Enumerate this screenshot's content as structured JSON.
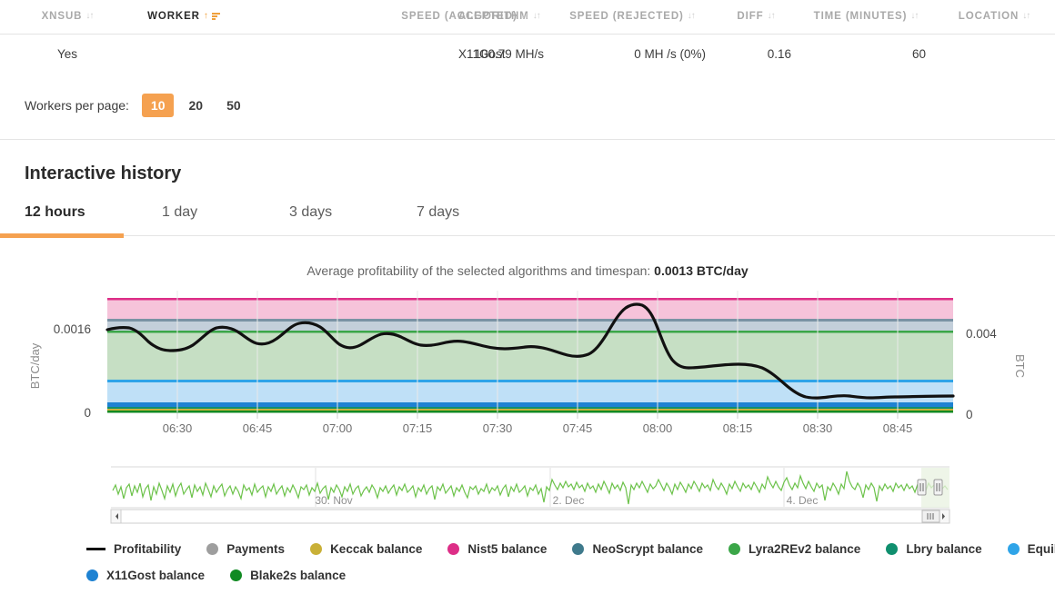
{
  "table": {
    "columns": [
      {
        "label": "XNSUB",
        "sorted": false
      },
      {
        "label": "WORKER",
        "sorted": true
      },
      {
        "label": "ALGORITHM",
        "sorted": false
      },
      {
        "label": "SPEED (ACCEPTED)",
        "sorted": false
      },
      {
        "label": "SPEED (REJECTED)",
        "sorted": false
      },
      {
        "label": "DIFF",
        "sorted": false
      },
      {
        "label": "TIME (MINUTES)",
        "sorted": false
      },
      {
        "label": "LOCATION",
        "sorted": false
      }
    ],
    "rows": [
      {
        "xnsub": "Yes",
        "worker": "",
        "algorithm": "X11Gost",
        "speed_accepted": "100.79 MH/s",
        "speed_rejected": "0 MH /s (0%)",
        "diff": "0.16",
        "time_minutes": "60",
        "location": ""
      }
    ]
  },
  "pagination": {
    "label": "Workers per page:",
    "options": [
      "10",
      "20",
      "50"
    ],
    "selected": "10"
  },
  "history": {
    "title": "Interactive history",
    "tabs": [
      {
        "label": "12 hours",
        "active": true
      },
      {
        "label": "1 day",
        "active": false
      },
      {
        "label": "3 days",
        "active": false
      },
      {
        "label": "7 days",
        "active": false
      }
    ],
    "subtitle_prefix": "Average profitability of the selected algorithms and timespan: ",
    "subtitle_value": "0.0013 BTC/day"
  },
  "chart_data": {
    "type": "line",
    "title": "",
    "xlabel": "",
    "ylabel": "BTC/day",
    "y2label": "BTC",
    "x_ticks": [
      "06:30",
      "06:45",
      "07:00",
      "07:15",
      "07:30",
      "07:45",
      "08:00",
      "08:15",
      "08:30",
      "08:45"
    ],
    "y_ticks": [
      "0",
      "0.0016"
    ],
    "ylim": [
      0,
      0.0022
    ],
    "y2_ticks": [
      "0",
      "0.004"
    ],
    "y2lim": [
      0,
      0.0055
    ],
    "grid": true,
    "legend_position": "bottom",
    "series": [
      {
        "name": "Profitability",
        "type": "line",
        "color": "#111111",
        "x": [
          "06:21",
          "06:24",
          "06:27",
          "06:30",
          "06:33",
          "06:36",
          "06:39",
          "06:42",
          "06:45",
          "06:48",
          "06:51",
          "06:54",
          "06:57",
          "07:00",
          "07:03",
          "07:06",
          "07:09",
          "07:12",
          "07:15",
          "07:18",
          "07:21",
          "07:24",
          "07:27",
          "07:30",
          "07:33",
          "07:36",
          "07:39",
          "07:42",
          "07:45",
          "07:48",
          "07:51",
          "07:54",
          "07:57",
          "08:00",
          "08:03",
          "08:06",
          "08:09",
          "08:12",
          "08:15",
          "08:18",
          "08:21",
          "08:24",
          "08:27",
          "08:30",
          "08:33",
          "08:36",
          "08:39",
          "08:42",
          "08:45",
          "08:48",
          "08:51",
          "08:54"
        ],
        "values": [
          0.0017,
          0.00171,
          0.00168,
          0.00161,
          0.00153,
          0.0015,
          0.0015,
          0.00154,
          0.00163,
          0.0017,
          0.0017,
          0.00166,
          0.0016,
          0.00157,
          0.00158,
          0.00165,
          0.00172,
          0.00173,
          0.0017,
          0.00162,
          0.00155,
          0.00152,
          0.00154,
          0.00158,
          0.00159,
          0.00158,
          0.00156,
          0.00154,
          0.00152,
          0.0015,
          0.00148,
          0.00147,
          0.00152,
          0.0017,
          0.00192,
          0.00196,
          0.0018,
          0.00149,
          0.00136,
          0.00135,
          0.00137,
          0.00138,
          0.00138,
          0.00135,
          0.00123,
          0.00105,
          0.0009,
          0.00083,
          0.00082,
          0.00085,
          0.00083,
          0.00084
        ]
      },
      {
        "name": "Payments",
        "type": "band",
        "color": "#9e9e9e",
        "band_top": 0.0,
        "band_bottom": 0.0
      },
      {
        "name": "Keccak balance",
        "type": "band",
        "color": "#c9b037",
        "band_top": 2e-05,
        "band_bottom": 0.0
      },
      {
        "name": "Nist5 balance",
        "type": "band",
        "color": "#dd2e87",
        "band_top": 0.00208,
        "band_bottom": 0.0019
      },
      {
        "name": "NeoScrypt balance",
        "type": "band",
        "color": "#3f7a8c",
        "band_top": 0.00187,
        "band_bottom": 0.00178
      },
      {
        "name": "Lyra2REv2 balance",
        "type": "band",
        "color": "#3ba648",
        "band_top": 0.00175,
        "band_bottom": 0.00174
      },
      {
        "name": "Lbry balance",
        "type": "band",
        "color": "#0f8f6e",
        "band_top": 2e-05,
        "band_bottom": 0.0
      },
      {
        "name": "Equihash balance",
        "type": "band",
        "color": "#2fa4e8",
        "band_top": 0.00031,
        "band_bottom": 6e-05
      },
      {
        "name": "X11Gost balance",
        "type": "band",
        "color": "#1e82d2",
        "band_top": 6e-05,
        "band_bottom": 3e-05
      },
      {
        "name": "Blake2s balance",
        "type": "band",
        "color": "#108a22",
        "band_top": 2e-05,
        "band_bottom": 1e-05
      }
    ],
    "legend": [
      {
        "label": "Profitability",
        "color": "#111111",
        "marker": "line"
      },
      {
        "label": "Payments",
        "color": "#9e9e9e",
        "marker": "dot"
      },
      {
        "label": "Keccak balance",
        "color": "#c9b037",
        "marker": "dot"
      },
      {
        "label": "Nist5 balance",
        "color": "#dd2e87",
        "marker": "dot"
      },
      {
        "label": "NeoScrypt balance",
        "color": "#3f7a8c",
        "marker": "dot"
      },
      {
        "label": "Lyra2REv2 balance",
        "color": "#3ba648",
        "marker": "dot"
      },
      {
        "label": "Lbry balance",
        "color": "#0f8f6e",
        "marker": "dot"
      },
      {
        "label": "Equihash balance",
        "color": "#2fa4e8",
        "marker": "dot"
      },
      {
        "label": "X11Gost balance",
        "color": "#1e82d2",
        "marker": "dot"
      },
      {
        "label": "Blake2s balance",
        "color": "#108a22",
        "marker": "dot"
      }
    ],
    "navigator": {
      "series_color": "#6cc24a",
      "x_ticks": [
        "30. Nov",
        "2. Dec",
        "4. Dec"
      ],
      "selected_range_right_edge": true
    }
  },
  "colors": {
    "accent": "#f5a150",
    "text": "#333333",
    "muted": "#a9a9a9",
    "border": "#e4e4e4"
  }
}
